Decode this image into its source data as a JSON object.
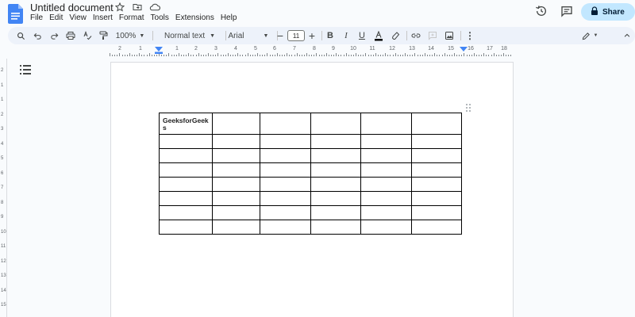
{
  "header": {
    "title": "Untitled document",
    "share_label": "Share",
    "menu": [
      "File",
      "Edit",
      "View",
      "Insert",
      "Format",
      "Tools",
      "Extensions",
      "Help"
    ]
  },
  "toolbar": {
    "zoom": "100%",
    "style": "Normal text",
    "font": "Arial",
    "font_size": "11"
  },
  "ruler": {
    "labels": [
      "2",
      "1",
      "1",
      "2",
      "3",
      "4",
      "5",
      "6",
      "7",
      "8",
      "9",
      "10",
      "11",
      "12",
      "13",
      "14",
      "15",
      "16",
      "17",
      "18"
    ]
  },
  "vruler": {
    "labels": [
      "2",
      "1",
      "1",
      "2",
      "3",
      "4",
      "5",
      "6",
      "7",
      "8",
      "9",
      "10",
      "11",
      "12",
      "13",
      "14",
      "15"
    ]
  },
  "table": {
    "rows": 8,
    "cols": 6,
    "cell_text": "GeeksforGeeks"
  },
  "colors": {
    "accent": "#c2e7ff",
    "doc_blue": "#4285f4",
    "toolbar_bg": "#edf2fa"
  }
}
